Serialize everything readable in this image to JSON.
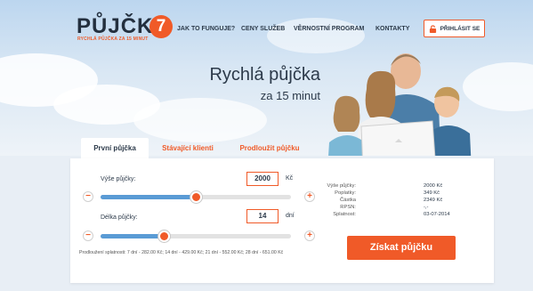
{
  "brand": {
    "name": "PŮJČKA",
    "number": "7",
    "tagline": "RYCHLÁ PŮJČKA ZA 15 MINUT",
    "accent": "#f05a28"
  },
  "nav": {
    "items": [
      "JAK TO FUNGUJE?",
      "CENY SLUŽEB",
      "VĚRNOSTNÍ PROGRAM",
      "KONTAKTY"
    ],
    "login_label": "PŘIHLÁSIT SE",
    "login_icon": "lock-icon"
  },
  "hero": {
    "title": "Rychlá půjčka",
    "subtitle": "za 15 minut"
  },
  "tabs": [
    "První půjčka",
    "Stávající klienti",
    "Prodloužit půjčku"
  ],
  "loan": {
    "amount_label": "Výše půjčky:",
    "amount_value": "2000",
    "amount_unit": "Kč",
    "amount_fraction": 0.5,
    "term_label": "Délka půjčky:",
    "term_value": "14",
    "term_unit": "dní",
    "term_fraction": 0.33,
    "minus": "−",
    "plus": "+",
    "extension_note": "Prodloužení splatnosti: 7 dní - 282.00 Kč; 14 dní - 429.00 Kč; 21 dní - 552.00 Kč; 28 dní - 651.00 Kč"
  },
  "summary": [
    {
      "key": "Výše půjčky:",
      "value": "2000 Kč"
    },
    {
      "key": "Poplatky:",
      "value": "349 Kč"
    },
    {
      "key": "Částka",
      "value": "2349 Kč"
    },
    {
      "key": "RPSN:",
      "value": "-,-"
    },
    {
      "key": "Splatnost:",
      "value": "03-07-2014"
    }
  ],
  "cta_label": "Získat půjčku"
}
